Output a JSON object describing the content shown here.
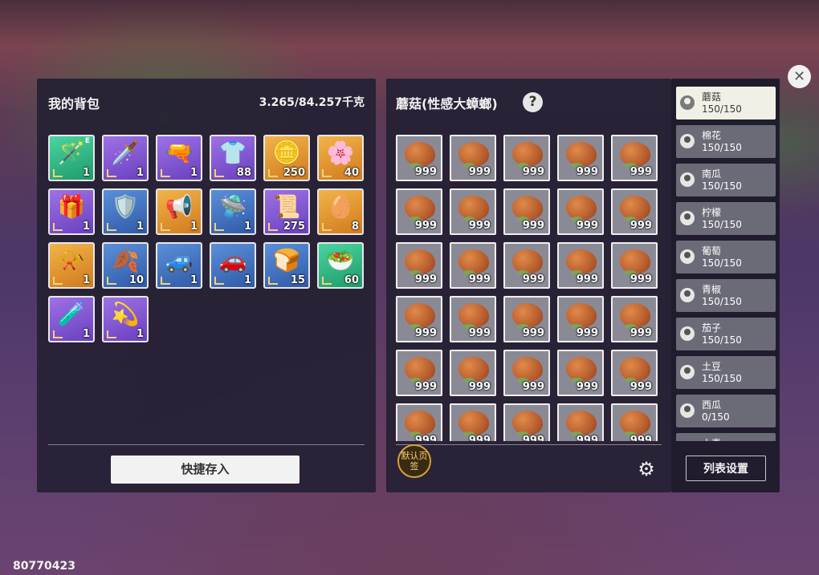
{
  "backpack": {
    "title": "我的背包",
    "weight": "3.265/84.257千克",
    "quick_deposit_label": "快捷存入",
    "items": [
      {
        "icon": "🪄",
        "count": "1",
        "rarity": "green",
        "tag": "E"
      },
      {
        "icon": "🗡️",
        "count": "1",
        "rarity": "purple",
        "tag": ""
      },
      {
        "icon": "🔫",
        "count": "1",
        "rarity": "purple",
        "tag": ""
      },
      {
        "icon": "👕",
        "count": "88",
        "rarity": "purple",
        "tag": ""
      },
      {
        "icon": "🪙",
        "count": "250",
        "rarity": "gold",
        "tag": ""
      },
      {
        "icon": "🌸",
        "count": "40",
        "rarity": "gold",
        "tag": ""
      },
      {
        "icon": "🎁",
        "count": "1",
        "rarity": "purple",
        "tag": ""
      },
      {
        "icon": "🛡️",
        "count": "1",
        "rarity": "blue",
        "tag": ""
      },
      {
        "icon": "📢",
        "count": "1",
        "rarity": "gold",
        "tag": ""
      },
      {
        "icon": "🛸",
        "count": "1",
        "rarity": "blue",
        "tag": ""
      },
      {
        "icon": "📜",
        "count": "275",
        "rarity": "purple",
        "tag": ""
      },
      {
        "icon": "🥚",
        "count": "8",
        "rarity": "gold",
        "tag": ""
      },
      {
        "icon": "📯",
        "count": "1",
        "rarity": "gold",
        "tag": ""
      },
      {
        "icon": "🍂",
        "count": "10",
        "rarity": "blue",
        "tag": ""
      },
      {
        "icon": "🚙",
        "count": "1",
        "rarity": "blue",
        "tag": ""
      },
      {
        "icon": "🚗",
        "count": "1",
        "rarity": "blue",
        "tag": ""
      },
      {
        "icon": "🍞",
        "count": "15",
        "rarity": "blue",
        "tag": ""
      },
      {
        "icon": "🥗",
        "count": "60",
        "rarity": "green",
        "tag": ""
      },
      {
        "icon": "🧪",
        "count": "1",
        "rarity": "purple",
        "tag": ""
      },
      {
        "icon": "💫",
        "count": "1",
        "rarity": "purple",
        "tag": ""
      }
    ]
  },
  "storage": {
    "title": "蘑菇(性感大蟑螂)",
    "help_icon": "?",
    "default_tab_label": "默认页签",
    "slot_count": "999",
    "slots": 30
  },
  "category_list": {
    "items": [
      {
        "name": "蘑菇",
        "count": "150/150",
        "active": true
      },
      {
        "name": "棉花",
        "count": "150/150"
      },
      {
        "name": "南瓜",
        "count": "150/150"
      },
      {
        "name": "柠檬",
        "count": "150/150"
      },
      {
        "name": "葡萄",
        "count": "150/150"
      },
      {
        "name": "青椒",
        "count": "150/150"
      },
      {
        "name": "茄子",
        "count": "150/150"
      },
      {
        "name": "土豆",
        "count": "150/150"
      },
      {
        "name": "西瓜",
        "count": "0/150"
      },
      {
        "name": "小麦",
        "count": ""
      }
    ],
    "settings_label": "列表设置"
  },
  "user_id": "80770423",
  "icons": {
    "close": "close-icon",
    "gear": "gear-icon",
    "help": "help-icon"
  }
}
